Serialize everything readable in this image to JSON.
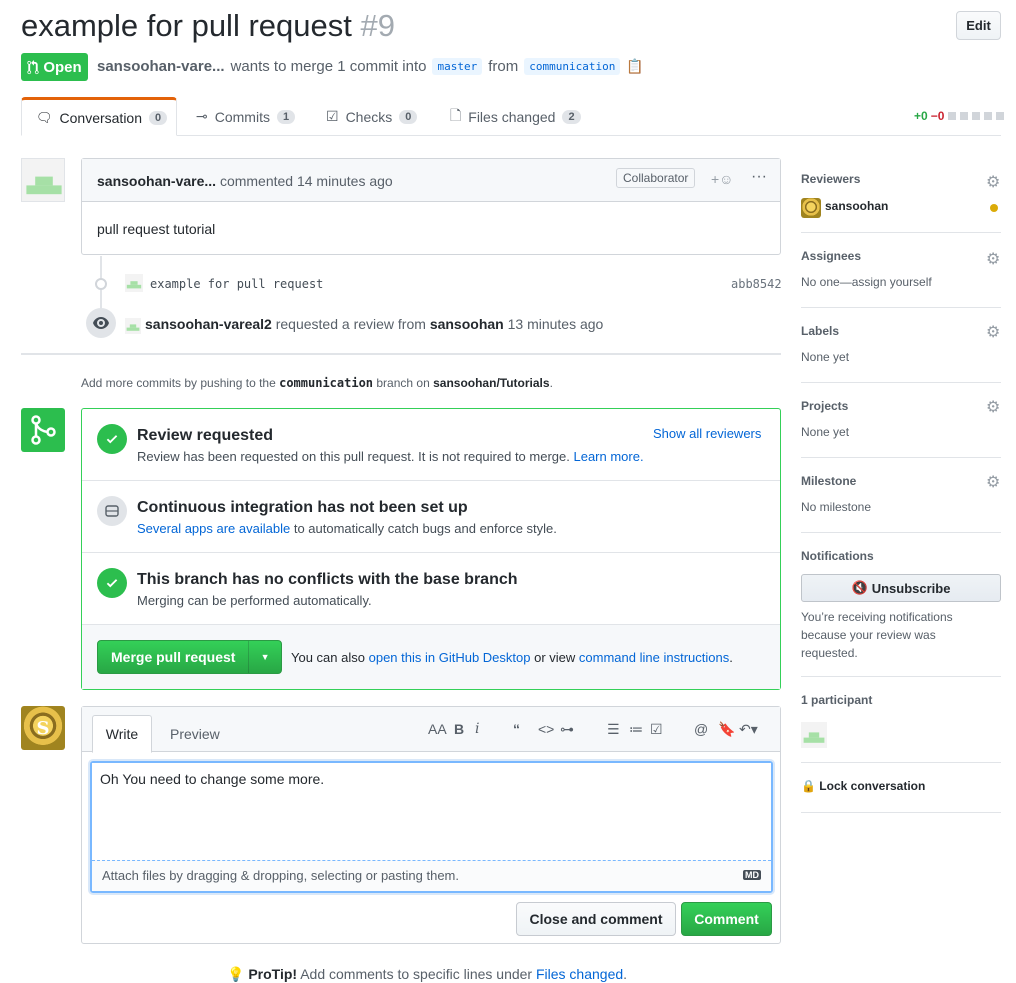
{
  "header": {
    "title": "example for pull request",
    "number": "#9",
    "edit_label": "Edit",
    "state": "Open",
    "author": "sansoohan-vare...",
    "merge_text": "wants to merge 1 commit into",
    "base_branch": "master",
    "from_text": "from",
    "head_branch": "communication"
  },
  "tabs": [
    {
      "label": "Conversation",
      "count": "0"
    },
    {
      "label": "Commits",
      "count": "1"
    },
    {
      "label": "Checks",
      "count": "0"
    },
    {
      "label": "Files changed",
      "count": "2"
    }
  ],
  "diffstat": {
    "additions": "+0",
    "deletions": "−0"
  },
  "comment": {
    "author": "sansoohan-vare...",
    "action": "commented 14 minutes ago",
    "role": "Collaborator",
    "body": "pull request tutorial"
  },
  "timeline": {
    "commit_message": "example for pull request",
    "commit_sha": "abb8542",
    "review_actor": "sansoohan-vareal2",
    "review_text": "requested a review from",
    "review_target": "sansoohan",
    "review_time": "13 minutes ago"
  },
  "push_hint": {
    "prefix": "Add more commits by pushing to the",
    "branch": "communication",
    "middle": "branch on",
    "repo": "sansoohan/Tutorials",
    "suffix": "."
  },
  "merge_box": {
    "review": {
      "title": "Review requested",
      "desc": "Review has been requested on this pull request. It is not required to merge.",
      "learn_more": "Learn more.",
      "show_all": "Show all reviewers"
    },
    "ci": {
      "title": "Continuous integration has not been set up",
      "link": "Several apps are available",
      "desc": "to automatically catch bugs and enforce style."
    },
    "conflicts": {
      "title": "This branch has no conflicts with the base branch",
      "desc": "Merging can be performed automatically."
    },
    "merge_button": "Merge pull request",
    "also_prefix": "You can also",
    "also_link1": "open this in GitHub Desktop",
    "also_middle": "or view",
    "also_link2": "command line instructions",
    "also_suffix": "."
  },
  "composer": {
    "tab_write": "Write",
    "tab_preview": "Preview",
    "text": "Oh You need to change some more.",
    "attach_hint": "Attach files by dragging & dropping, selecting or pasting them.",
    "md_badge": "MD",
    "close_label": "Close and comment",
    "comment_label": "Comment"
  },
  "protip": {
    "label": "ProTip!",
    "text": "Add comments to specific lines under",
    "link": "Files changed",
    "suffix": "."
  },
  "sidebar": {
    "reviewers": {
      "title": "Reviewers",
      "name": "sansoohan"
    },
    "assignees": {
      "title": "Assignees",
      "value": "No one—assign yourself"
    },
    "labels": {
      "title": "Labels",
      "value": "None yet"
    },
    "projects": {
      "title": "Projects",
      "value": "None yet"
    },
    "milestone": {
      "title": "Milestone",
      "value": "No milestone"
    },
    "notifications": {
      "title": "Notifications",
      "button": "Unsubscribe",
      "reason": "You’re receiving notifications because your review was requested."
    },
    "participants": {
      "title": "1 participant"
    },
    "lock": "Lock conversation"
  },
  "colors": {
    "green": "#2cbe4e",
    "link": "#0366d6",
    "tab_accent": "#e36209",
    "pending_dot": "#dbab09"
  }
}
